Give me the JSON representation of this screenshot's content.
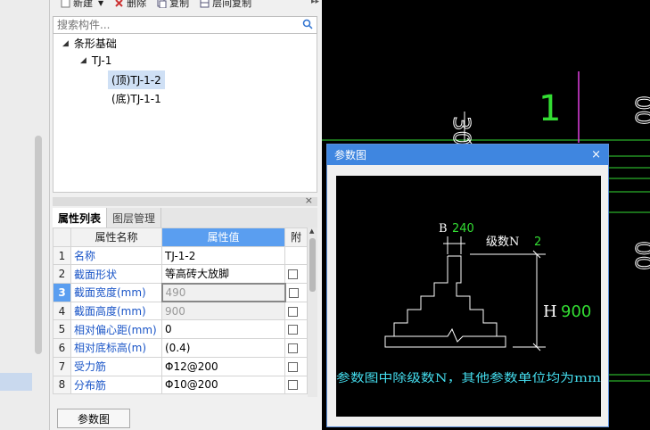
{
  "toolbar": {
    "new": "新建",
    "delete": "删除",
    "copy": "复制",
    "floor_copy": "层间复制"
  },
  "search": {
    "placeholder": "搜索构件..."
  },
  "tree": {
    "root": "条形基础",
    "child": "TJ-1",
    "leaf_top": "(顶)TJ-1-2",
    "leaf_bottom": "(底)TJ-1-1"
  },
  "tabs": {
    "props": "属性列表",
    "layers": "图层管理"
  },
  "grid": {
    "col_name": "属性名称",
    "col_value": "属性值",
    "col_attach": "附",
    "rows": [
      {
        "idx": "1",
        "name": "名称",
        "value": "TJ-1-2"
      },
      {
        "idx": "2",
        "name": "截面形状",
        "value": "等高砖大放脚"
      },
      {
        "idx": "3",
        "name": "截面宽度(mm)",
        "value": "490"
      },
      {
        "idx": "4",
        "name": "截面高度(mm)",
        "value": "900"
      },
      {
        "idx": "5",
        "name": "相对偏心距(mm)",
        "value": "0"
      },
      {
        "idx": "6",
        "name": "相对底标高(m)",
        "value": "(0.4)"
      },
      {
        "idx": "7",
        "name": "受力筋",
        "value": "Φ12@200"
      },
      {
        "idx": "8",
        "name": "分布筋",
        "value": "Φ10@200"
      }
    ]
  },
  "param_button": "参数图",
  "canvas": {
    "dim_300": "300",
    "label_1": "1",
    "dim_right": "00"
  },
  "dialog": {
    "title": "参数图",
    "close": "×",
    "b_label": "B",
    "b_value": "240",
    "n_label": "级数N",
    "n_value": "2",
    "h_label": "H",
    "h_value": "900",
    "note": "参数图中除级数N，其他参数单位均为mm"
  },
  "colors": {
    "accent": "#3f86e0",
    "cad_green": "#33dd33",
    "cad_magenta": "#e040e0",
    "note_cyan": "#44ddee"
  }
}
